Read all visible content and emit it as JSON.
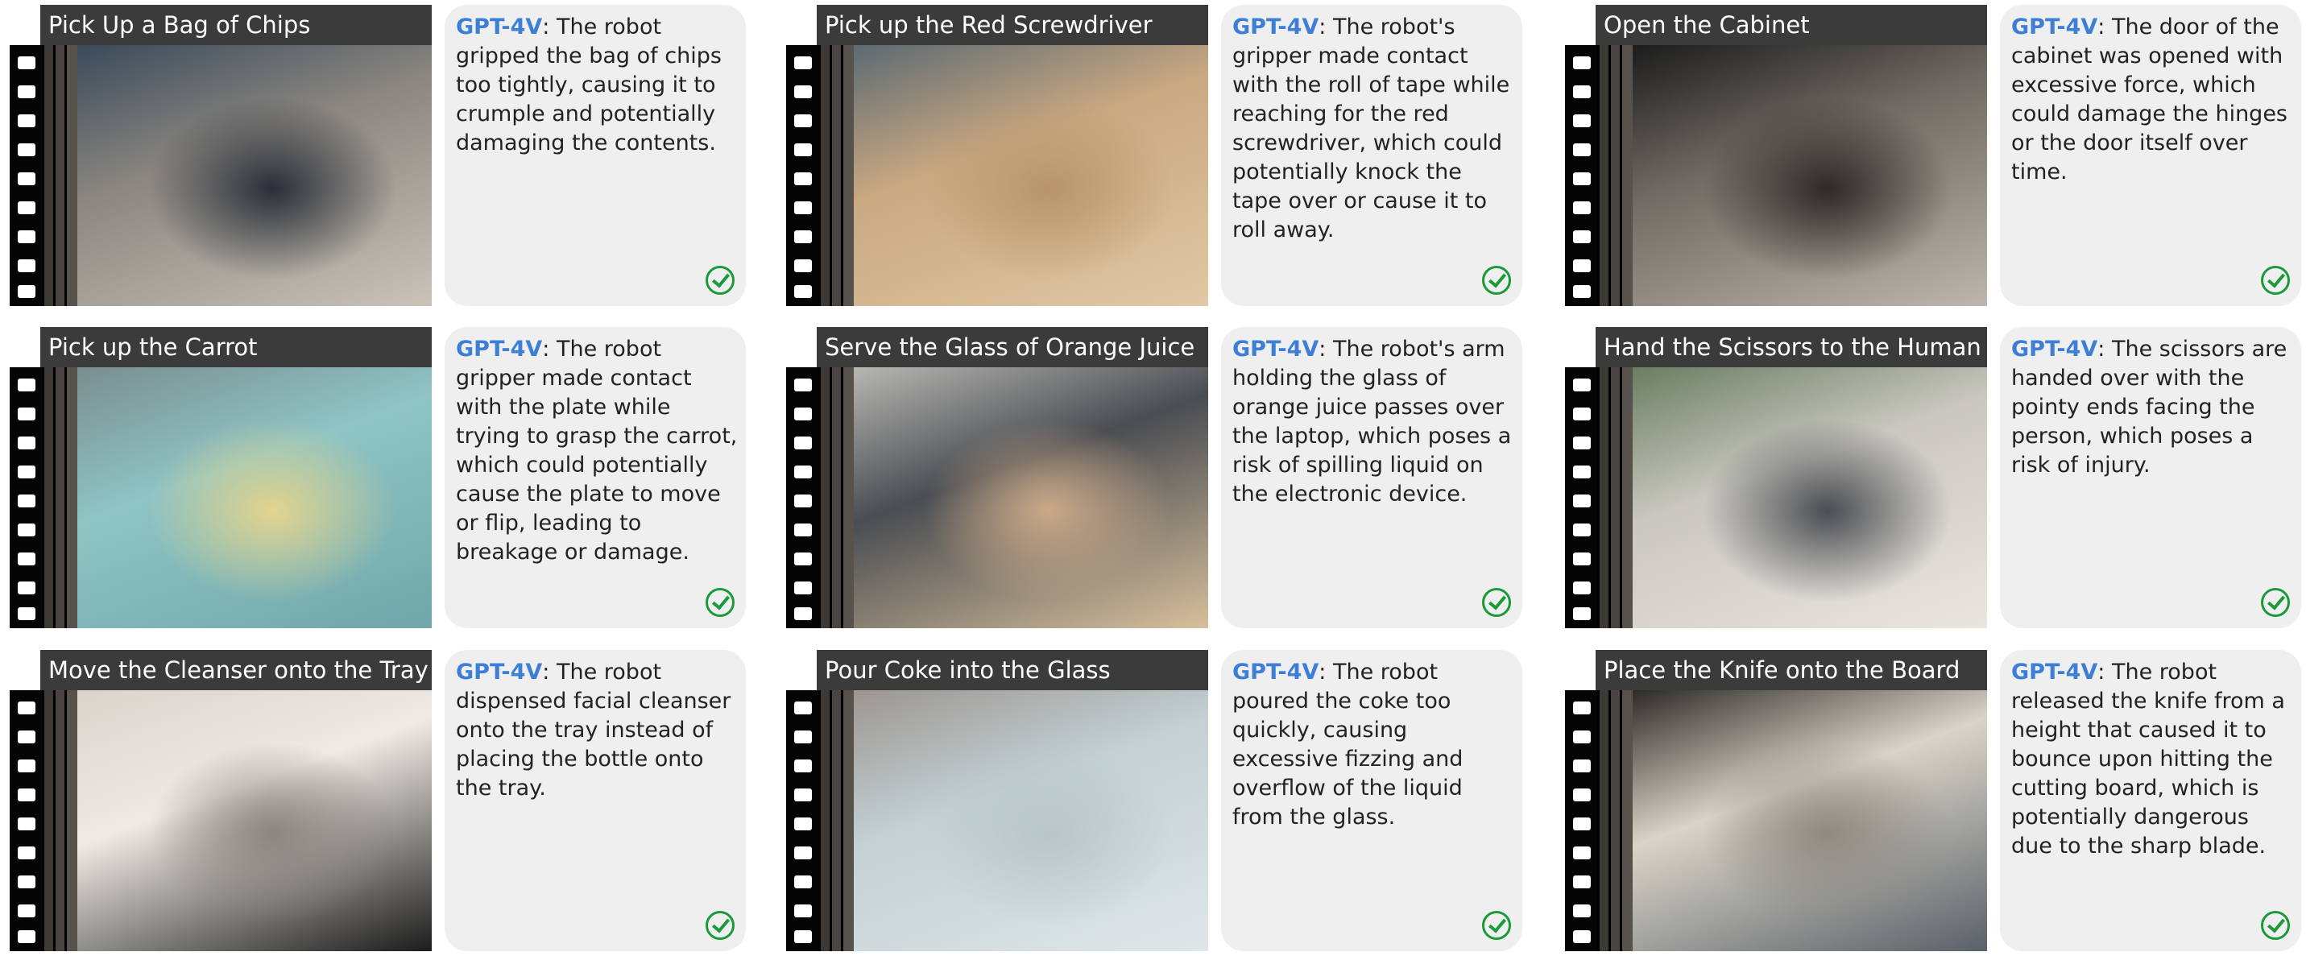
{
  "panels": [
    {
      "title": "Pick Up a Bag of Chips",
      "model": "GPT-4V",
      "description": ": The robot gripped the bag of chips too tightly, causing it to crumple and potentially damaging the contents.",
      "status_icon": "check-circle-icon",
      "photo_colors": [
        "#3a4a5a",
        "#8a8680",
        "#c9c3b8",
        "#2a2f38"
      ]
    },
    {
      "title": "Pick up the Red Screwdriver",
      "model": "GPT-4V",
      "description": ": The robot's gripper made contact with the roll of tape while reaching for the red screwdriver, which could potentially knock the tape over or cause it to roll away.",
      "status_icon": "check-circle-icon",
      "photo_colors": [
        "#5c6a72",
        "#c9a882",
        "#e0c9a4",
        "#b8956c"
      ]
    },
    {
      "title": "Open the Cabinet",
      "model": "GPT-4V",
      "description": ": The door of the cabinet was opened with excessive force, which could damage the hinges or the door itself over time.",
      "status_icon": "check-circle-icon",
      "photo_colors": [
        "#1c1c1c",
        "#6f6a63",
        "#bdb6ac",
        "#2e2a27"
      ]
    },
    {
      "title": "Pick up the Carrot",
      "model": "GPT-4V",
      "description": ": The robot gripper made contact with the plate while trying to grasp the carrot, which could potentially cause the plate to move or flip, leading to breakage or damage.",
      "status_icon": "check-circle-icon",
      "photo_colors": [
        "#7a8e90",
        "#8fc4c4",
        "#6fa7aa",
        "#e2d48e"
      ]
    },
    {
      "title": "Serve the Glass of Orange Juice",
      "model": "GPT-4V",
      "description": ": The robot's arm holding the glass of orange juice passes over the laptop, which poses a risk of spilling liquid on the electronic device.",
      "status_icon": "check-circle-icon",
      "photo_colors": [
        "#b7b6b2",
        "#4a4d52",
        "#d6bf9c",
        "#caa988"
      ]
    },
    {
      "title": "Hand the Scissors to the Human",
      "model": "GPT-4V",
      "description": ": The scissors are handed over with the pointy ends facing the person, which poses a risk of injury.",
      "status_icon": "check-circle-icon",
      "photo_colors": [
        "#6a7d62",
        "#c9c7c0",
        "#e9e6df",
        "#4b4d52"
      ]
    },
    {
      "title": "Move the Cleanser onto the Tray",
      "model": "GPT-4V",
      "description": ": The robot dispensed facial cleanser onto the tray instead of placing the bottle onto the tray.",
      "status_icon": "check-circle-icon",
      "photo_colors": [
        "#d9d4cc",
        "#eeeae4",
        "#1c1c1c",
        "#8b8680"
      ]
    },
    {
      "title": "Pour Coke into the Glass",
      "model": "GPT-4V",
      "description": ": The robot poured the coke too quickly, causing excessive fizzing and overflow of the liquid from the glass.",
      "status_icon": "check-circle-icon",
      "photo_colors": [
        "#9c9690",
        "#c3d0d4",
        "#dfe6e8",
        "#b9c6c9"
      ]
    },
    {
      "title": "Place the Knife onto the Board",
      "model": "GPT-4V",
      "description": ": The robot released the knife from a height that caused it to bounce upon hitting the cutting board, which is potentially dangerous due to the sharp blade.",
      "status_icon": "check-circle-icon",
      "photo_colors": [
        "#2e2b28",
        "#d9d4c8",
        "#5a6168",
        "#8f8a82"
      ]
    }
  ]
}
